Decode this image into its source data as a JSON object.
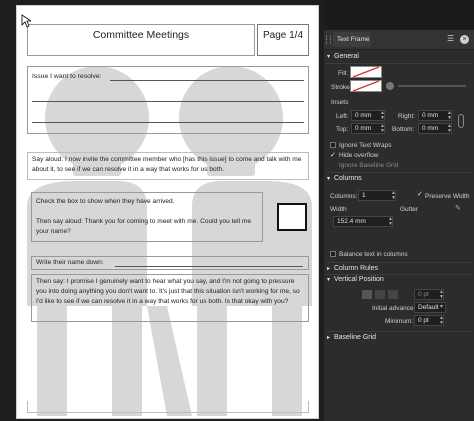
{
  "document": {
    "title": "Committee Meetings",
    "page_label": "Page 1/4",
    "issue_label": "Issue I want to resolve:",
    "say_aloud": "Say aloud: I now invite the committee member who [has this issue] to come and talk with me about it, to see if we can resolve it  in a way that works for us both.",
    "checkbox_text_1": "Check the box to show when they have arrived.",
    "checkbox_text_2": "Then say aloud: Thank you for coming to meet with me. Could you tell me your name?",
    "name_label": "Write their name down:",
    "promise_text": "Then say: I promise I genuinely want to hear what you say, and I'm not going to pressure you into doing anything you don't want to. It's just that this situation isn't working for me, so I'd like to see if we can resolve it in a way that works for us both. Is that okay with  you?"
  },
  "panel": {
    "tab_title": "Text Frame",
    "general": "General",
    "fill_label": "Fill:",
    "stroke_label": "Stroke:",
    "insets_label": "Insets",
    "left_label": "Left:",
    "left_value": "0 mm",
    "right_label": "Right:",
    "right_value": "0 mm",
    "top_label": "Top:",
    "top_value": "0 mm",
    "bottom_label": "Bottom:",
    "bottom_value": "0 mm",
    "ignore_text_wraps": "Ignore Text Wraps",
    "hide_overflow": "Hide overflow",
    "ignore_baseline_grid": "Ignore Baseline Grid",
    "columns_section": "Columns",
    "columns_label": "Columns:",
    "columns_value": "1",
    "preserve_width": "Preserve Width",
    "width_label": "Width",
    "gutter_label": "Gutter",
    "width_value": "152.4 mm",
    "balance_text": "Balance text in columns",
    "column_rules": "Column Rules",
    "vertical_position": "Vertical Position",
    "vp_value": "0 pt",
    "initial_advance_label": "Initial advance:",
    "initial_advance_value": "Default",
    "minimum_label": "Minimum:",
    "minimum_value": "0 pt",
    "baseline_grid": "Baseline Grid",
    "colors": {
      "panel_bg": "#2c2c2c",
      "accent": "#2e6fd6",
      "slash": "#d9342b"
    }
  }
}
